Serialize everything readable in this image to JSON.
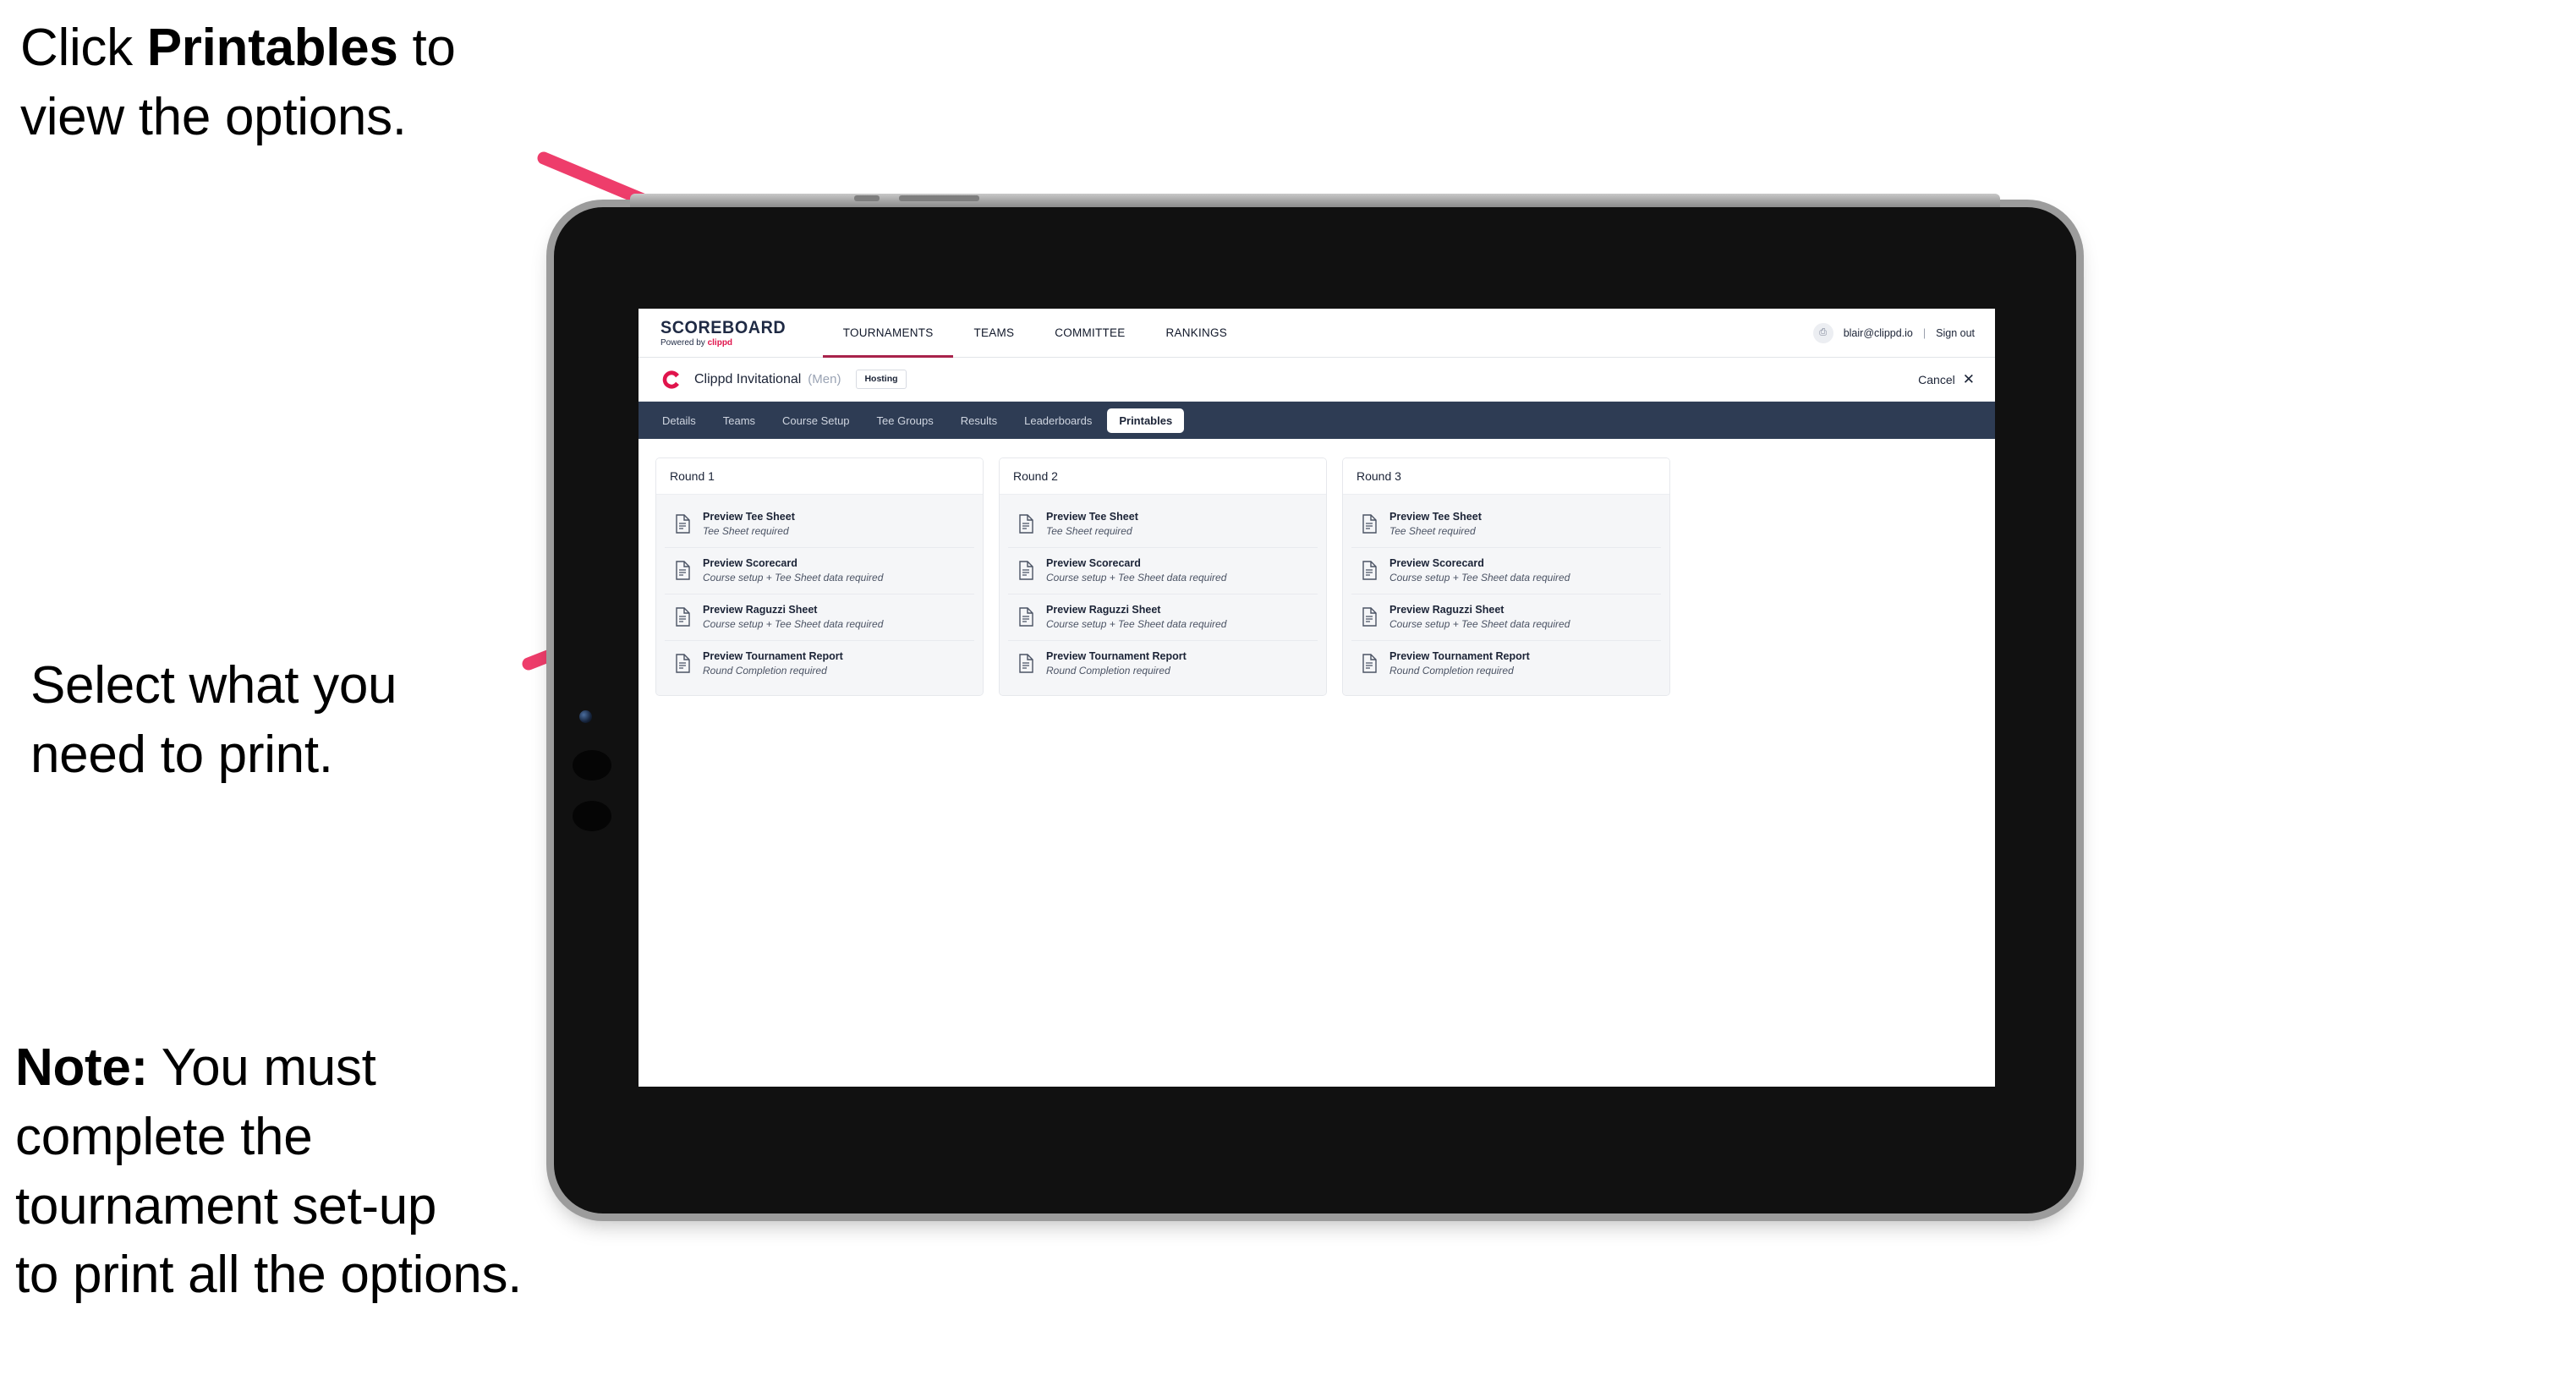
{
  "annotations": {
    "top": "Click **Printables** to\nview the options.",
    "top_plain_1": "Click ",
    "top_bold": "Printables",
    "top_plain_2": " to\nview the options.",
    "middle": "Select what you\n need to print.",
    "note_bold": "Note:",
    "note_rest": " You must\ncomplete the\ntournament set-up\nto print all the options."
  },
  "colors": {
    "arrow_pink": "#ee3d6b",
    "brand_crimson": "#e0144c",
    "tabstrip_navy": "#2e3c54",
    "nav_underline": "#a8224a",
    "card_bg": "#f5f6f8",
    "device_body": "#111111",
    "device_frame": "#9c9c9c"
  },
  "browser": {
    "topbar": {
      "brand_word": "SCOREBOARD",
      "brand_sub_prefix": "Powered by ",
      "brand_sub_name": "clippd",
      "nav_items": [
        {
          "label": "TOURNAMENTS",
          "active": true
        },
        {
          "label": "TEAMS",
          "active": false
        },
        {
          "label": "COMMITTEE",
          "active": false
        },
        {
          "label": "RANKINGS",
          "active": false
        }
      ],
      "avatar_glyph": "⎙",
      "user_email": "blair@clippd.io",
      "divider": "|",
      "sign_out": "Sign out"
    },
    "tourney_bar": {
      "logo_letter": "C",
      "name": "Clippd Invitational",
      "gender": "(Men)",
      "badge": "Hosting",
      "cancel_label": "Cancel",
      "cancel_icon": "✕"
    },
    "tabs": [
      {
        "label": "Details",
        "active": false
      },
      {
        "label": "Teams",
        "active": false
      },
      {
        "label": "Course Setup",
        "active": false
      },
      {
        "label": "Tee Groups",
        "active": false
      },
      {
        "label": "Results",
        "active": false
      },
      {
        "label": "Leaderboards",
        "active": false
      },
      {
        "label": "Printables",
        "active": true
      }
    ],
    "rounds": [
      {
        "title": "Round 1",
        "items": [
          {
            "title": "Preview Tee Sheet",
            "subtitle": "Tee Sheet required"
          },
          {
            "title": "Preview Scorecard",
            "subtitle": "Course setup + Tee Sheet data required"
          },
          {
            "title": "Preview Raguzzi Sheet",
            "subtitle": "Course setup + Tee Sheet data required"
          },
          {
            "title": "Preview Tournament Report",
            "subtitle": "Round Completion required"
          }
        ]
      },
      {
        "title": "Round 2",
        "items": [
          {
            "title": "Preview Tee Sheet",
            "subtitle": "Tee Sheet required"
          },
          {
            "title": "Preview Scorecard",
            "subtitle": "Course setup + Tee Sheet data required"
          },
          {
            "title": "Preview Raguzzi Sheet",
            "subtitle": "Course setup + Tee Sheet data required"
          },
          {
            "title": "Preview Tournament Report",
            "subtitle": "Round Completion required"
          }
        ]
      },
      {
        "title": "Round 3",
        "items": [
          {
            "title": "Preview Tee Sheet",
            "subtitle": "Tee Sheet required"
          },
          {
            "title": "Preview Scorecard",
            "subtitle": "Course setup + Tee Sheet data required"
          },
          {
            "title": "Preview Raguzzi Sheet",
            "subtitle": "Course setup + Tee Sheet data required"
          },
          {
            "title": "Preview Tournament Report",
            "subtitle": "Round Completion required"
          }
        ]
      }
    ]
  }
}
